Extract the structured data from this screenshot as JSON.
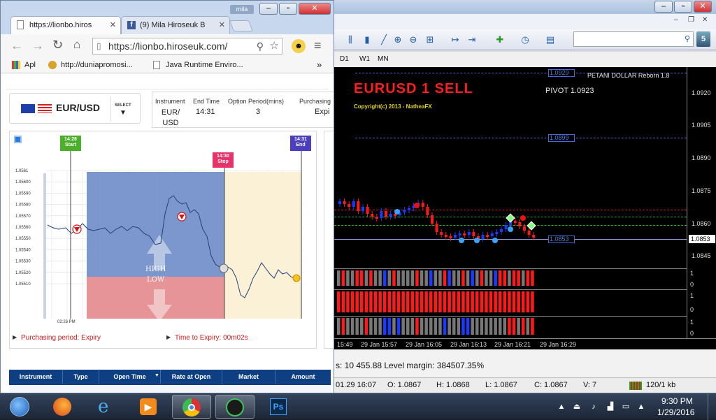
{
  "chrome": {
    "tabs": [
      {
        "title": "https://lionbo.hiros"
      },
      {
        "title": "(9) Mila Hiroseuk B"
      }
    ],
    "profile_name": "mila",
    "url": "https://lionbo.hiroseuk.com/",
    "bookmarks": [
      {
        "label": "Apl"
      },
      {
        "label": "http://duniapromosi..."
      },
      {
        "label": "Java Runtime Enviro..."
      }
    ],
    "bookmarks_more": "»"
  },
  "trading": {
    "pair": "EUR/USD",
    "select_label": "SELECT",
    "info_headers": [
      "Instrument",
      "End Time",
      "Option Period(mins)",
      "Purchasing"
    ],
    "info_values": [
      "EUR/\nUSD",
      "14:31",
      "3",
      "Expi"
    ],
    "markers": {
      "start": {
        "time": "14:28",
        "label": "Start"
      },
      "stop": {
        "time": "14:30",
        "label": "Stop"
      },
      "end": {
        "time": "14:31",
        "label": "End"
      }
    },
    "y_ticks": [
      "1.0561",
      "1.05600",
      "1.05590",
      "1.05580",
      "1.05570",
      "1.05560",
      "1.05550",
      "1.05540",
      "1.05530",
      "1.05520",
      "1.05510"
    ],
    "x_label": "02:26 PM",
    "high_label": "HIGH",
    "low_label": "LOW",
    "purchasing_period": "Purchasing period: Expiry",
    "time_to_expiry": "Time to Expiry: 00m02s",
    "table_headers": [
      "Instrument",
      "Type",
      "Open Time",
      "Rate at Open",
      "Market",
      "Amount"
    ]
  },
  "mt4": {
    "timeframes": [
      "D1",
      "W1",
      "MN"
    ],
    "chart_title": "EURUSD 1  SELL",
    "copyright": "Copyright(c) 2013 - NatheaFX",
    "pivot": "PIVOT 1.0923",
    "indicator_name": "PETANI DOLLAR Reborn 1.8",
    "level_top": "1.0929",
    "level_mid": "1.0899",
    "level_bid": "1.0853",
    "price_ticks": [
      "1.0920",
      "1.0905",
      "1.0890",
      "1.0875",
      "1.0860",
      "1.0845"
    ],
    "price_current": "1.0853",
    "sub_labels": [
      "1",
      "0",
      "1",
      "0",
      "1",
      "0"
    ],
    "time_ticks": [
      "15:49",
      "29 Jan 15:57",
      "29 Jan 16:05",
      "29 Jan 16:13",
      "29 Jan 16:21",
      "29 Jan 16:29"
    ],
    "terminal_text": "s: 10 455.88  Level margin: 384507.35%",
    "status": {
      "datetime": "01.29 16:07",
      "open": "O: 1.0867",
      "high": "H: 1.0868",
      "low": "L: 1.0867",
      "close": "C: 1.0867",
      "volume": "V: 7",
      "traffic": "120/1 kb"
    },
    "badge": "5"
  },
  "taskbar": {
    "time": "9:30 PM",
    "date": "1/29/2016",
    "ps_label": "Ps"
  },
  "colors": {
    "bull": "#1a3cff",
    "bear": "#ff1a1a",
    "accent_green": "#4caf2a",
    "accent_pink": "#e8336a",
    "accent_purple": "#4b3fbf"
  }
}
